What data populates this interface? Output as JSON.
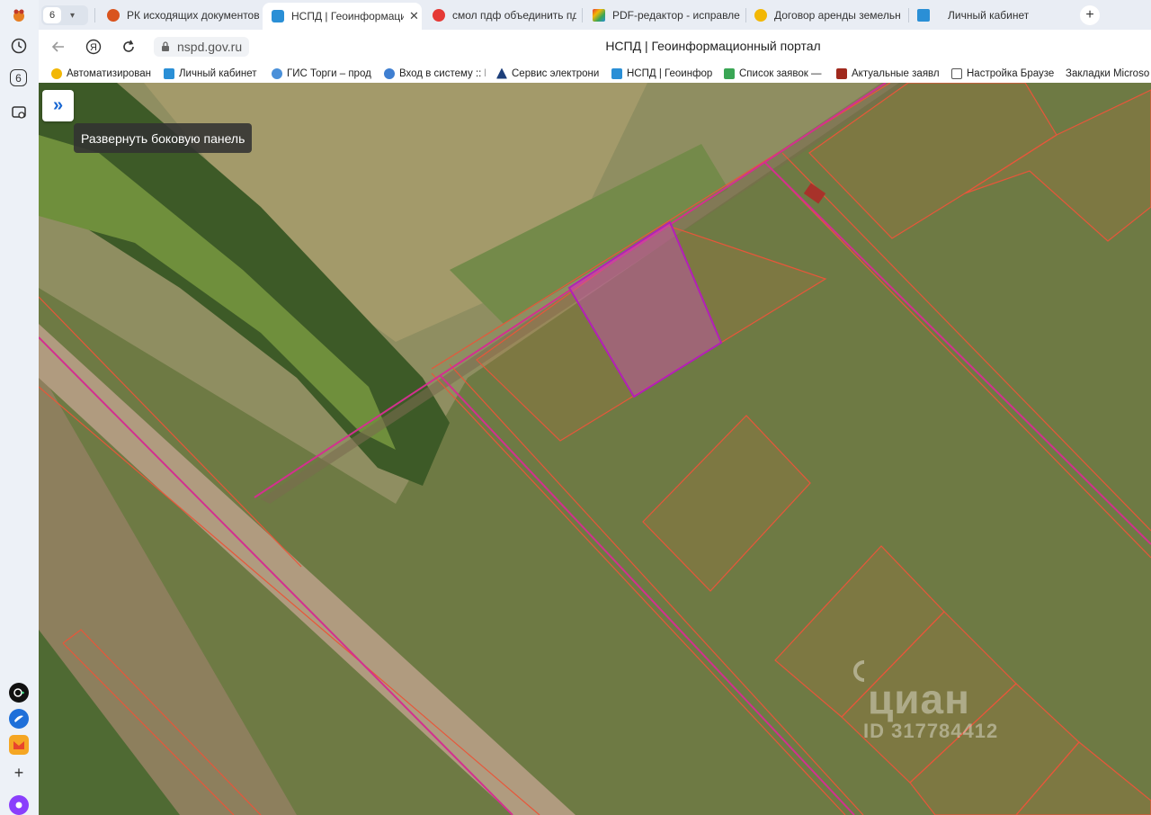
{
  "tabs": {
    "counter": "6",
    "items": [
      {
        "title": "РК исходящих документов",
        "active": false,
        "color": "#d9541e"
      },
      {
        "title": "НСПД | Геоинформаци",
        "active": true,
        "color": "#2a8fd6"
      },
      {
        "title": "смол пдф объединить пдф",
        "active": false,
        "color": "#e53935"
      },
      {
        "title": "PDF-редактор - исправле",
        "active": false,
        "color": "#7b5bd6"
      },
      {
        "title": "Договор аренды земельн",
        "active": false,
        "color": "#f2b705"
      },
      {
        "title": "Личный кабинет",
        "active": false,
        "color": "#2a8fd6"
      }
    ],
    "close_label": "✕",
    "new_tab_label": "+"
  },
  "address": {
    "url": "nspd.gov.ru",
    "page_title": "НСПД | Геоинформационный портал"
  },
  "bookmarks": [
    {
      "label": "Автоматизирован",
      "color": "#f2b705"
    },
    {
      "label": "Личный кабинет",
      "color": "#2a8fd6"
    },
    {
      "label": "ГИС Торги – прод",
      "color": "#4a90d9"
    },
    {
      "label": "Вход в систему :: I",
      "color": "#3f7fd1"
    },
    {
      "label": "Сервис электрони",
      "color": "#1d3f7a"
    },
    {
      "label": "НСПД | Геоинфор",
      "color": "#2a8fd6"
    },
    {
      "label": "Список заявок —",
      "color": "#3aa655"
    },
    {
      "label": "Актуальные заявл",
      "color": "#a0291d"
    },
    {
      "label": "Настройка Браузе",
      "color": "#ffffff"
    },
    {
      "label": "Закладки Microso",
      "color": "#ffffff"
    }
  ],
  "left_rail": {
    "tabs_count": "6"
  },
  "map": {
    "expand_tooltip": "Развернуть боковую панель",
    "expand_icon": "»",
    "watermark_brand": "циан",
    "watermark_id": "ID 317784412"
  }
}
